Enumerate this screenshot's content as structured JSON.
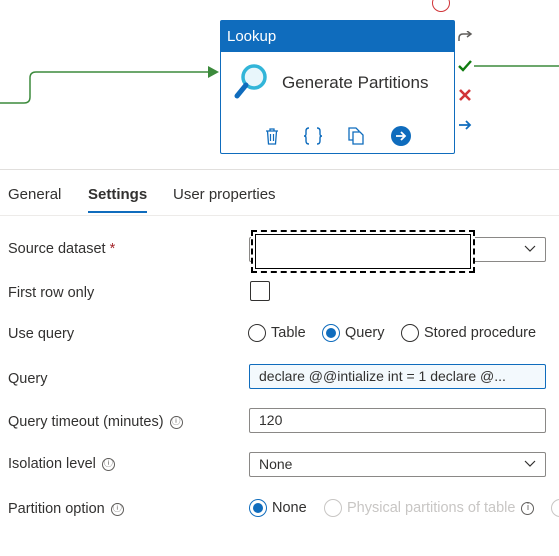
{
  "canvas": {
    "activity": {
      "type_label": "Lookup",
      "name": "Generate Partitions",
      "actions": [
        "delete-icon",
        "code-icon",
        "copy-icon",
        "navigate-icon"
      ]
    },
    "side_connectors": [
      "skip-icon",
      "success-icon",
      "failure-icon",
      "completion-icon"
    ]
  },
  "tabs": [
    {
      "label": "General",
      "active": false
    },
    {
      "label": "Settings",
      "active": true
    },
    {
      "label": "User properties",
      "active": false
    }
  ],
  "form": {
    "source_dataset": {
      "label": "Source dataset",
      "required_mark": "*",
      "value": ""
    },
    "first_row_only": {
      "label": "First row only",
      "checked": false
    },
    "use_query": {
      "label": "Use query",
      "options": [
        "Table",
        "Query",
        "Stored procedure"
      ],
      "selected": "Query"
    },
    "query": {
      "label": "Query",
      "value": "declare @@intialize int = 1 declare @..."
    },
    "query_timeout": {
      "label": "Query timeout (minutes)",
      "info_icon": "ⓘ",
      "value": "120"
    },
    "isolation_level": {
      "label": "Isolation level",
      "info_icon": "ⓘ",
      "value": "None"
    },
    "partition_option": {
      "label": "Partition option",
      "info_icon": "ⓘ",
      "options": [
        "None",
        "Physical partitions of table"
      ],
      "selected": "None"
    }
  },
  "colors": {
    "accent": "#0f6cbd",
    "success": "#107c10",
    "failure": "#d13438",
    "link_line": "#3c8a3c"
  }
}
